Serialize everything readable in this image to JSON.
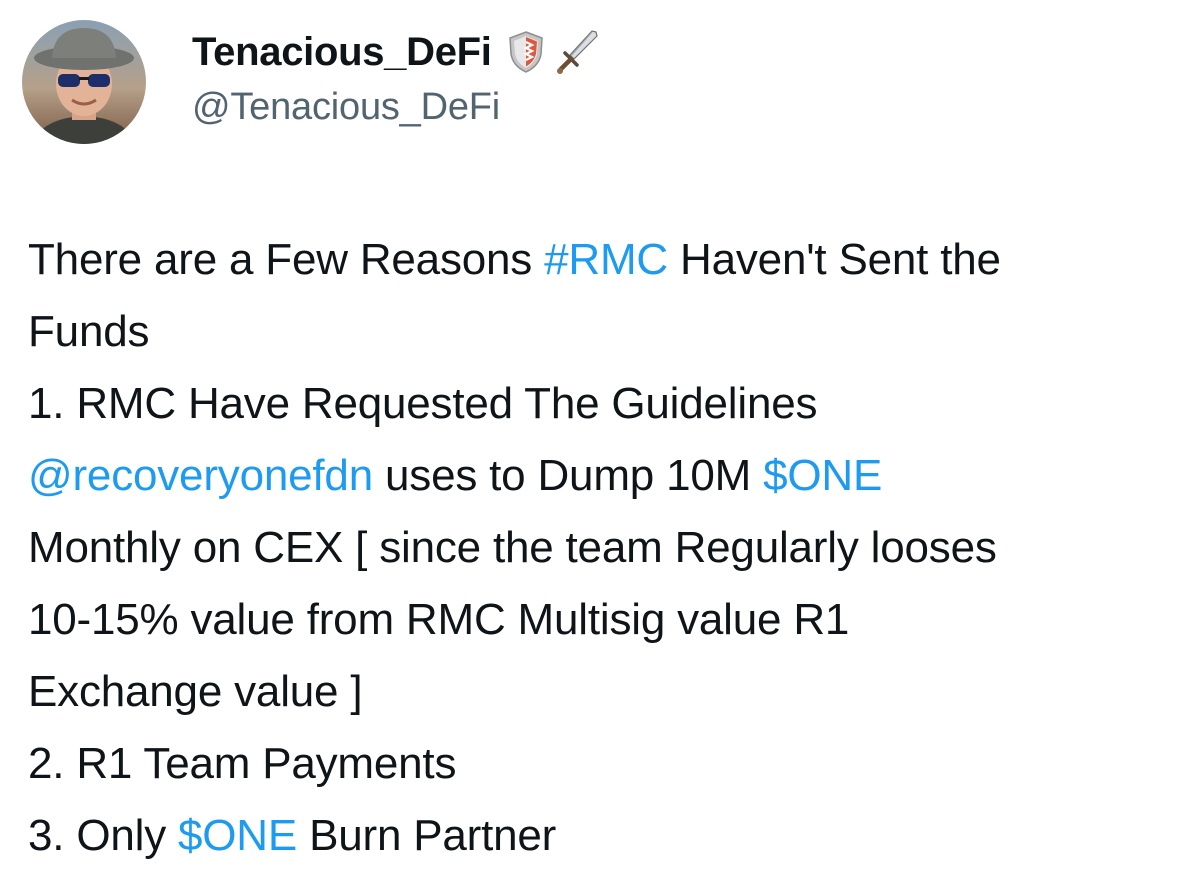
{
  "author": {
    "display_name": "Tenacious_DeFi",
    "handle": "@Tenacious_DeFi",
    "badge_icon": "shield-icon",
    "emoji_icon": "sword-icon"
  },
  "colors": {
    "link": "#1d9bf0",
    "text": "#0f1419",
    "secondary": "#536471"
  },
  "tweet": {
    "line1": {
      "a": "There are a Few Reasons ",
      "hashtag": "#RMC",
      "b": " Haven't Sent the"
    },
    "line2": "Funds",
    "line3": "1. RMC Have Requested The Guidelines",
    "line4": {
      "mention": "@recoveryonefdn",
      "a": " uses to Dump 10M ",
      "cashtag": "$ONE"
    },
    "line5": "Monthly on CEX [ since the team Regularly looses",
    "line6": "10-15% value from RMC Multisig value R1",
    "line7": "Exchange value ]",
    "line8": "2. R1 Team Payments",
    "line9": {
      "a": "3. Only ",
      "cashtag": "$ONE",
      "b": " Burn Partner"
    }
  }
}
